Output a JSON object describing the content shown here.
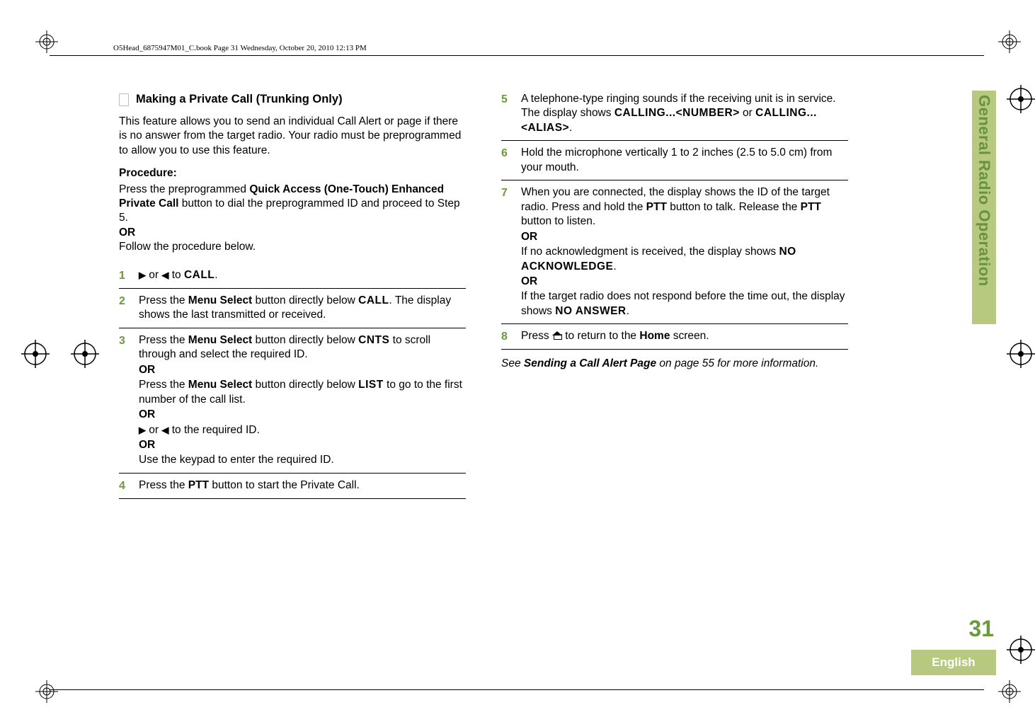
{
  "header": {
    "runhead": "O5Head_6875947M01_C.book  Page 31  Wednesday, October 20, 2010  12:13 PM"
  },
  "side": {
    "label": "General Radio Operation",
    "page_number": "31",
    "language": "English"
  },
  "left": {
    "title": "Making a Private Call (Trunking Only)",
    "intro": "This feature allows you to send an individual Call Alert or page if there is no answer from the target radio. Your radio must be preprogrammed to allow you to use this feature.",
    "procedure_label": "Procedure:",
    "pre1a": "Press the preprogrammed ",
    "pre1b": "Quick Access (One-Touch) Enhanced Private Call",
    "pre1c": " button to dial the preprogrammed ID and proceed to Step 5.",
    "or": "OR",
    "pre2": "Follow the procedure below.",
    "s1": {
      "num": "1",
      "a": " or ",
      "b": " to ",
      "call": "CALL",
      "c": "."
    },
    "s2": {
      "num": "2",
      "a": "Press the ",
      "ms": "Menu Select",
      "b": " button directly below ",
      "call": "CALL",
      "c": ". The display shows the last transmitted or received."
    },
    "s3": {
      "num": "3",
      "a": "Press the ",
      "ms": "Menu Select",
      "b": " button directly below ",
      "cnts": "CNTS",
      "c": " to scroll through and select the required ID.",
      "d": "Press the ",
      "e": " button directly below ",
      "list": "LIST",
      "f": " to go to the first number of the call list.",
      "g": " or ",
      "h": " to the required ID.",
      "i": "Use the keypad to enter the required ID."
    },
    "s4": {
      "num": "4",
      "a": "Press the ",
      "ptt": "PTT",
      "b": " button to start the Private Call."
    }
  },
  "right": {
    "s5": {
      "num": "5",
      "a": "A telephone-type ringing sounds if the receiving unit is in service. The display shows ",
      "c1": "CALLING...<NUMBER>",
      "b": " or ",
      "c2": "CALLING...<ALIAS>",
      "c": "."
    },
    "s6": {
      "num": "6",
      "a": "Hold the microphone vertically 1 to 2 inches (2.5 to 5.0 cm) from your mouth."
    },
    "s7": {
      "num": "7",
      "a": "When you are connected, the display shows the ID of the target radio. Press and hold the ",
      "ptt": "PTT",
      "b": " button to talk. Release the ",
      "c": " button to listen.",
      "d": "If no acknowledgment is received, the display shows ",
      "noack": "NO ACKNOWLEDGE",
      "e": ".",
      "f": "If the target radio does not respond before the time out, the display shows ",
      "noans": "NO ANSWER",
      "g": "."
    },
    "s8": {
      "num": "8",
      "a": "Press ",
      "b": " to return to the ",
      "home": "Home",
      "c": " screen."
    },
    "footer_a": "See ",
    "footer_b": "Sending a Call Alert Page",
    "footer_c": " on page 55 for more information."
  },
  "or_label": "OR"
}
